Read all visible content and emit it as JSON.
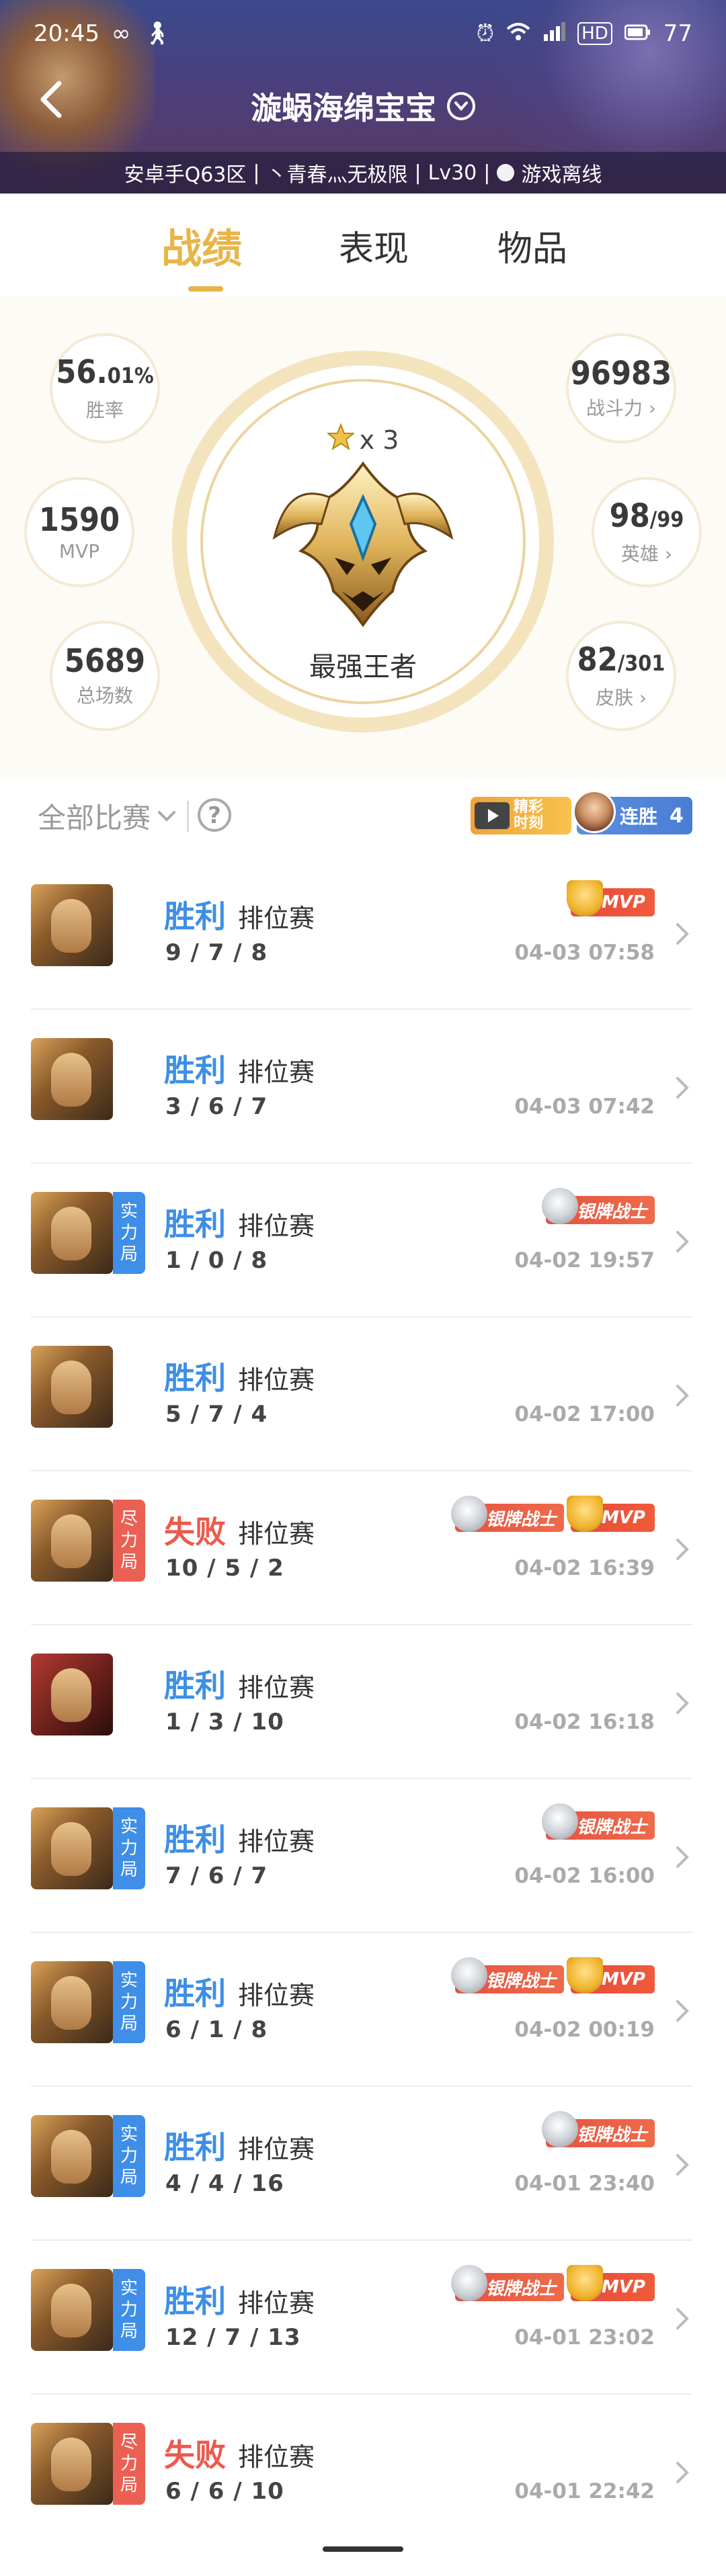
{
  "status_bar": {
    "time": "20:45",
    "battery": "77"
  },
  "header": {
    "title": "漩蜗海绵宝宝",
    "subtitle_server": "安卓手Q63区",
    "subtitle_nick": "丶青春灬无极限",
    "subtitle_level": "Lv30",
    "subtitle_status": "游戏离线"
  },
  "tabs": [
    {
      "label": "战绩",
      "active": true
    },
    {
      "label": "表现",
      "active": false
    },
    {
      "label": "物品",
      "active": false
    }
  ],
  "stats": {
    "win_rate_main": "56.",
    "win_rate_small": "01%",
    "win_rate_label": "胜率",
    "mvp_value": "1590",
    "mvp_label": "MVP",
    "total_value": "5689",
    "total_label": "总场数",
    "power_value": "96983",
    "power_label": "战斗力",
    "heroes_main": "98",
    "heroes_small": "/99",
    "heroes_label": "英雄",
    "skins_main": "82",
    "skins_small": "/301",
    "skins_label": "皮肤"
  },
  "rank": {
    "stars": "x 3",
    "name": "最强王者"
  },
  "filter": {
    "label": "全部比赛",
    "highlight_line1": "精彩",
    "highlight_line2": "时刻",
    "streak_label": "连胜",
    "streak_count": "4"
  },
  "matches": [
    {
      "result": "胜利",
      "outcome": "win",
      "mode": "排位赛",
      "kda": "9 / 7 / 8",
      "time": "04-03 07:58",
      "tag": "",
      "badges": [
        "MVP"
      ],
      "hero": "gold"
    },
    {
      "result": "胜利",
      "outcome": "win",
      "mode": "排位赛",
      "kda": "3 / 6 / 7",
      "time": "04-03 07:42",
      "tag": "",
      "badges": [],
      "hero": "gold"
    },
    {
      "result": "胜利",
      "outcome": "win",
      "mode": "排位赛",
      "kda": "1 / 0 / 8",
      "time": "04-02 19:57",
      "tag": "实力局",
      "tag_color": "blue",
      "badges": [
        "银牌战士"
      ],
      "hero": "gold"
    },
    {
      "result": "胜利",
      "outcome": "win",
      "mode": "排位赛",
      "kda": "5 / 7 / 4",
      "time": "04-02 17:00",
      "tag": "",
      "badges": [],
      "hero": "gold"
    },
    {
      "result": "失败",
      "outcome": "lose",
      "mode": "排位赛",
      "kda": "10 / 5 / 2",
      "time": "04-02 16:39",
      "tag": "尽力局",
      "tag_color": "red",
      "badges": [
        "银牌战士",
        "MVP"
      ],
      "hero": "gold"
    },
    {
      "result": "胜利",
      "outcome": "win",
      "mode": "排位赛",
      "kda": "1 / 3 / 10",
      "time": "04-02 16:18",
      "tag": "",
      "badges": [],
      "hero": "red"
    },
    {
      "result": "胜利",
      "outcome": "win",
      "mode": "排位赛",
      "kda": "7 / 6 / 7",
      "time": "04-02 16:00",
      "tag": "实力局",
      "tag_color": "blue",
      "badges": [
        "银牌战士"
      ],
      "hero": "gold"
    },
    {
      "result": "胜利",
      "outcome": "win",
      "mode": "排位赛",
      "kda": "6 / 1 / 8",
      "time": "04-02 00:19",
      "tag": "实力局",
      "tag_color": "blue",
      "badges": [
        "银牌战士",
        "MVP"
      ],
      "hero": "gold"
    },
    {
      "result": "胜利",
      "outcome": "win",
      "mode": "排位赛",
      "kda": "4 / 4 / 16",
      "time": "04-01 23:40",
      "tag": "实力局",
      "tag_color": "blue",
      "badges": [
        "银牌战士"
      ],
      "hero": "gold"
    },
    {
      "result": "胜利",
      "outcome": "win",
      "mode": "排位赛",
      "kda": "12 / 7 / 13",
      "time": "04-01 23:02",
      "tag": "实力局",
      "tag_color": "blue",
      "badges": [
        "银牌战士",
        "MVP"
      ],
      "hero": "gold"
    },
    {
      "result": "失败",
      "outcome": "lose",
      "mode": "排位赛",
      "kda": "6 / 6 / 10",
      "time": "04-01 22:42",
      "tag": "尽力局",
      "tag_color": "red",
      "badges": [],
      "hero": "gold"
    }
  ],
  "colors": {
    "accent": "#e8b548",
    "win": "#3d8fe6",
    "lose": "#ec5a4c"
  }
}
